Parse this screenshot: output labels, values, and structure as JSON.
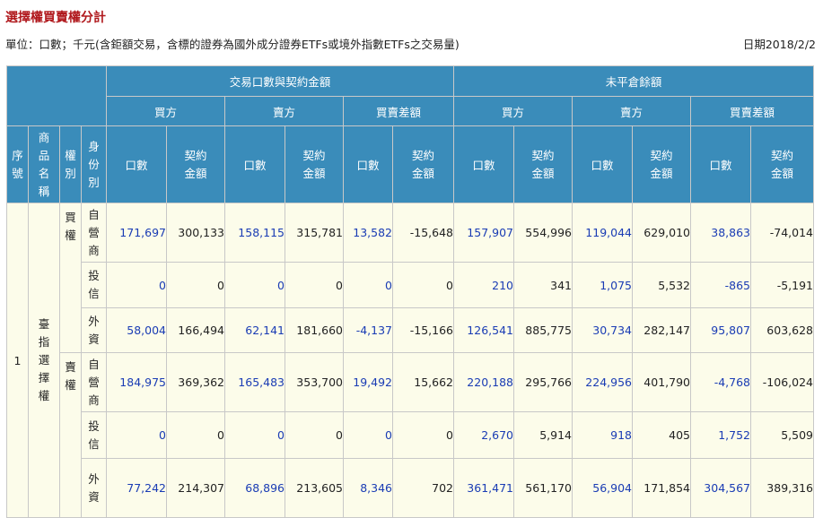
{
  "title": "選擇權買賣權分計",
  "unit_text": "單位：口數；千元(含鉅額交易，含標的證券為國外成分證券ETFs或境外指數ETFs之交易量)",
  "date_text": "日期2018/2/2",
  "headers": {
    "trading": "交易口數與契約金額",
    "open_interest": "未平倉餘額",
    "buy": "買方",
    "sell": "賣方",
    "net": "買賣差額",
    "seq": [
      "序",
      "號"
    ],
    "product": [
      "商",
      "品",
      "名",
      "稱"
    ],
    "right": [
      "權",
      "別"
    ],
    "identity": [
      "身",
      "份",
      "別"
    ],
    "lots": "口數",
    "amount": [
      "契約",
      "金額"
    ]
  },
  "product": {
    "seq": "1",
    "name": [
      "臺",
      "指",
      "選",
      "擇",
      "權"
    ],
    "groups": [
      {
        "right": [
          "買",
          "權"
        ],
        "rows": [
          {
            "identity": [
              "自",
              "營",
              "商"
            ],
            "values": [
              "171,697",
              "300,133",
              "158,115",
              "315,781",
              "13,582",
              "-15,648",
              "157,907",
              "554,996",
              "119,044",
              "629,010",
              "38,863",
              "-74,014"
            ]
          },
          {
            "identity": [
              "投",
              "信"
            ],
            "values": [
              "0",
              "0",
              "0",
              "0",
              "0",
              "0",
              "210",
              "341",
              "1,075",
              "5,532",
              "-865",
              "-5,191"
            ]
          },
          {
            "identity": [
              "外",
              "資"
            ],
            "values": [
              "58,004",
              "166,494",
              "62,141",
              "181,660",
              "-4,137",
              "-15,166",
              "126,541",
              "885,775",
              "30,734",
              "282,147",
              "95,807",
              "603,628"
            ]
          }
        ]
      },
      {
        "right": [
          "賣",
          "權"
        ],
        "rows": [
          {
            "identity": [
              "自",
              "營",
              "商"
            ],
            "values": [
              "184,975",
              "369,362",
              "165,483",
              "353,700",
              "19,492",
              "15,662",
              "220,188",
              "295,766",
              "224,956",
              "401,790",
              "-4,768",
              "-106,024"
            ]
          },
          {
            "identity": [
              "投",
              "信"
            ],
            "values": [
              "0",
              "0",
              "0",
              "0",
              "0",
              "0",
              "2,670",
              "5,914",
              "918",
              "405",
              "1,752",
              "5,509"
            ]
          },
          {
            "identity": [
              "外",
              "資"
            ],
            "values": [
              "77,242",
              "214,307",
              "68,896",
              "213,605",
              "8,346",
              "702",
              "361,471",
              "561,170",
              "56,904",
              "171,854",
              "304,567",
              "389,316"
            ]
          }
        ]
      }
    ]
  },
  "colors": {
    "title": "#b0181c",
    "header_bg": "#3a8cba",
    "body_bg": "#fcfcea",
    "lots_text": "#1a3cb4"
  }
}
